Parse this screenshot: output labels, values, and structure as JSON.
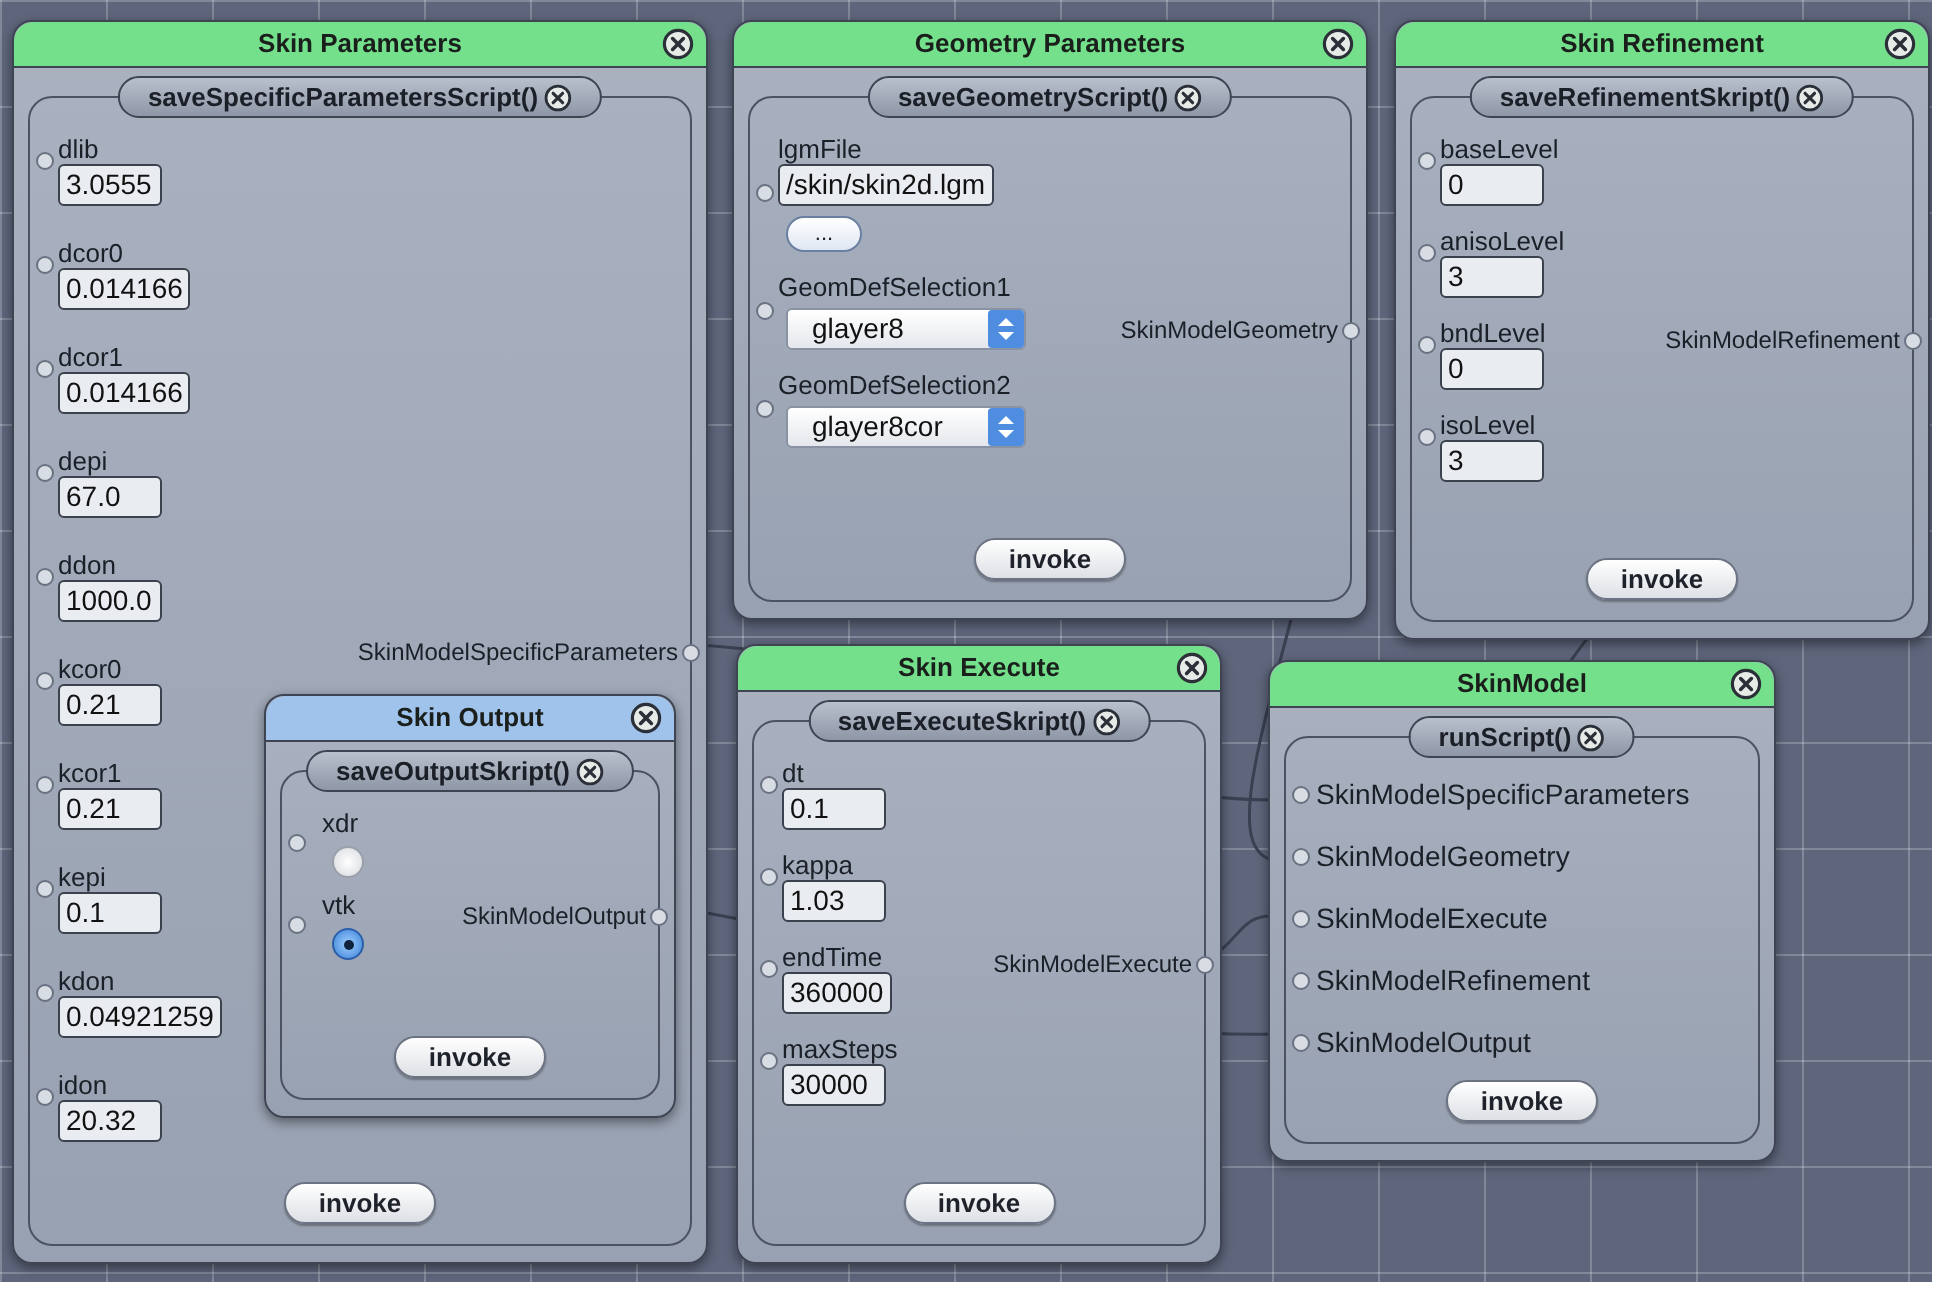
{
  "windows": [
    {
      "title": "Skin Parameters",
      "color": "#74e08c",
      "method": "saveSpecificParametersScript()",
      "inputs": [
        {
          "kind": "text",
          "label": "dlib",
          "value": "3.0555"
        },
        {
          "kind": "text",
          "label": "dcor0",
          "value": "0.014166"
        },
        {
          "kind": "text",
          "label": "dcor1",
          "value": "0.014166"
        },
        {
          "kind": "text",
          "label": "depi",
          "value": "67.0"
        },
        {
          "kind": "text",
          "label": "ddon",
          "value": "1000.0"
        },
        {
          "kind": "text",
          "label": "kcor0",
          "value": "0.21"
        },
        {
          "kind": "text",
          "label": "kcor1",
          "value": "0.21"
        },
        {
          "kind": "text",
          "label": "kepi",
          "value": "0.1"
        },
        {
          "kind": "text",
          "label": "kdon",
          "value": "0.04921259"
        },
        {
          "kind": "text",
          "label": "idon",
          "value": "20.32"
        }
      ],
      "output": "SkinModelSpecificParameters",
      "invoke": "invoke"
    },
    {
      "title": "Geometry Parameters",
      "color": "#74e08c",
      "method": "saveGeometryScript()",
      "inputs": [
        {
          "kind": "file",
          "label": "lgmFile",
          "value": "/skin/skin2d.lgm",
          "button": "..."
        },
        {
          "kind": "select",
          "label": "GeomDefSelection1",
          "value": "glayer8"
        },
        {
          "kind": "select",
          "label": "GeomDefSelection2",
          "value": "glayer8cor"
        }
      ],
      "output": "SkinModelGeometry",
      "invoke": "invoke"
    },
    {
      "title": "Skin Refinement",
      "color": "#74e08c",
      "method": "saveRefinementSkript()",
      "inputs": [
        {
          "kind": "text",
          "label": "baseLevel",
          "value": "0"
        },
        {
          "kind": "text",
          "label": "anisoLevel",
          "value": "3"
        },
        {
          "kind": "text",
          "label": "bndLevel",
          "value": "0"
        },
        {
          "kind": "text",
          "label": "isoLevel",
          "value": "3"
        }
      ],
      "output": "SkinModelRefinement",
      "invoke": "invoke"
    },
    {
      "title": "Skin Output",
      "color": "#9fc3ea",
      "method": "saveOutputSkript()",
      "inputs": [
        {
          "kind": "radio",
          "label": "xdr",
          "selected": false
        },
        {
          "kind": "radio",
          "label": "vtk",
          "selected": true
        }
      ],
      "output": "SkinModelOutput",
      "invoke": "invoke"
    },
    {
      "title": "Skin Execute",
      "color": "#74e08c",
      "method": "saveExecuteSkript()",
      "inputs": [
        {
          "kind": "text",
          "label": "dt",
          "value": "0.1"
        },
        {
          "kind": "text",
          "label": "kappa",
          "value": "1.03"
        },
        {
          "kind": "text",
          "label": "endTime",
          "value": "360000"
        },
        {
          "kind": "text",
          "label": "maxSteps",
          "value": "30000"
        }
      ],
      "output": "SkinModelExecute",
      "invoke": "invoke"
    },
    {
      "title": "SkinModel",
      "color": "#74e08c",
      "method": "runScript()",
      "inputs": [
        {
          "kind": "port",
          "label": "SkinModelSpecificParameters"
        },
        {
          "kind": "port",
          "label": "SkinModelGeometry"
        },
        {
          "kind": "port",
          "label": "SkinModelExecute"
        },
        {
          "kind": "port",
          "label": "SkinModelRefinement"
        },
        {
          "kind": "port",
          "label": "SkinModelOutput"
        }
      ],
      "invoke": "invoke"
    }
  ]
}
